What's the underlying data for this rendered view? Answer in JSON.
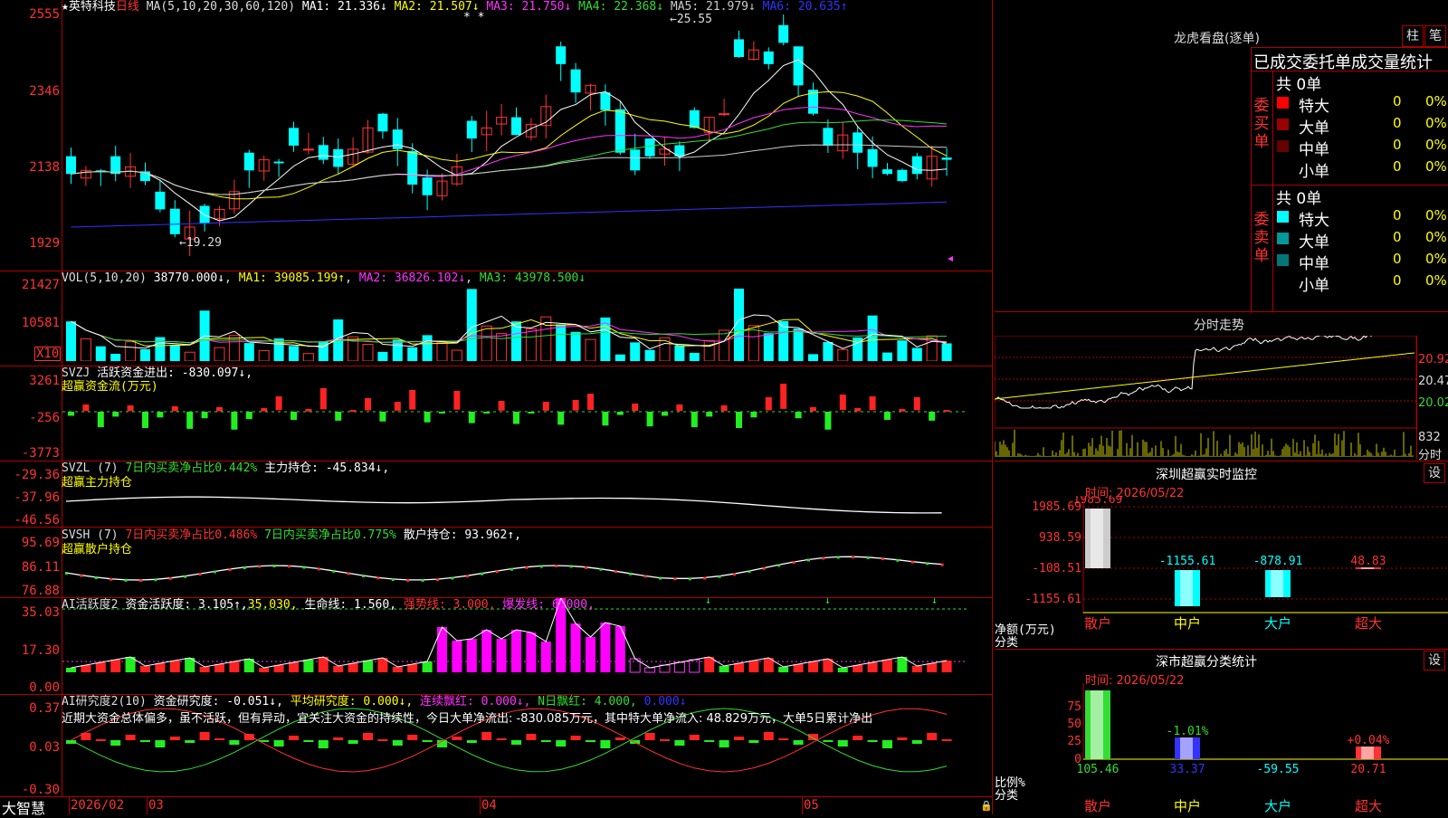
{
  "stock": {
    "star": "★",
    "name": "英特科技",
    "period": "日线"
  },
  "main": {
    "ma_label": "MA(5,10,20,30,60,120)",
    "ma_values": [
      {
        "name": "MA1",
        "val": "21.336↓",
        "color": "#ffffff"
      },
      {
        "name": "MA2",
        "val": "21.507↓",
        "color": "#ffff00"
      },
      {
        "name": "MA3",
        "val": "21.750↓",
        "color": "#ff33ff"
      },
      {
        "name": "MA4",
        "val": "22.368↓",
        "color": "#33dd33"
      },
      {
        "name": "MA5",
        "val": "21.979↓",
        "color": "#cccccc"
      },
      {
        "name": "MA6",
        "val": "20.635↑",
        "color": "#3333ff"
      }
    ],
    "yticks": [
      "2555",
      "2346",
      "2138",
      "1929"
    ],
    "high_mark": "25.55",
    "low_mark": "19.29",
    "flags": "* *"
  },
  "vol": {
    "label": "VOL(5,10,20)",
    "cur": "38770.000↓",
    "ma1": "MA1: 39085.199↑",
    "ma2": "MA2: 36826.102↓",
    "ma3": "MA3: 43978.500↓",
    "yticks": [
      "21427",
      "10581"
    ],
    "unit": "X10"
  },
  "svzj": {
    "label": "SVZJ",
    "title": "活跃资金进出: -830.097↓,",
    "sub": "超赢资金流(万元)",
    "yticks": [
      "3261",
      "-256",
      "-3773"
    ]
  },
  "svzl": {
    "label": "SVZL (7)",
    "p1": "7日内买卖净占比0.442%",
    "p2": "主力持仓: -45.834↓,",
    "sub": "超赢主力持仓",
    "yticks": [
      "-29.36",
      "-37.96",
      "-46.56"
    ]
  },
  "svsh": {
    "label": "SVSH (7)",
    "p1": "7日内买卖净占比0.486%",
    "p2": "7日内买卖净占比0.775%",
    "p3": "散户持仓: 93.962↑,",
    "sub": "超赢散户持仓",
    "yticks": [
      "95.69",
      "86.11",
      "76.88"
    ]
  },
  "ai2": {
    "label": "AI活跃度2",
    "p1": "资金活跃度: 3.105↑,",
    "p2": "35.030,",
    "p3": "生命线: 1.560,",
    "p4": "强势线: 3.000,",
    "p5": "爆发线: 6.000,",
    "yticks": [
      "35.03",
      "17.30",
      "0.00"
    ]
  },
  "ai_res": {
    "label": "AI研究度2(10)",
    "p1": "资金研究度: -0.051↓,",
    "p2": "平均研究度: 0.000↓,",
    "p3": "连续飘红: 0.000↓,",
    "p4": "N日飘红: 4.000,",
    "p5": "0.000↓",
    "text": "近期大资金总体偏多，虽不活跃，但有异动，宜关注大资金的持续性，今日大单净流出: -830.085万元，其中特大单净流入: 48.829万元，大单5日累计净出",
    "yticks": [
      "0.37",
      "0.03",
      "-0.30"
    ]
  },
  "xaxis": {
    "brand": "大智慧",
    "ticks": [
      "2026/02",
      "03",
      "04",
      "05"
    ]
  },
  "lhb": {
    "title": "龙虎看盘(逐单)",
    "btn1": "柱",
    "btn2": "笔",
    "subtitle": "已成交委托单成交量统计",
    "buy": {
      "side": "委买单",
      "total": "共 0单",
      "rows": [
        {
          "name": "特大",
          "n": "0",
          "p": "0%",
          "c": "#ff0000"
        },
        {
          "name": "大单",
          "n": "0",
          "p": "0%",
          "c": "#990000"
        },
        {
          "name": "中单",
          "n": "0",
          "p": "0%",
          "c": "#660000"
        },
        {
          "name": "小单",
          "n": "0",
          "p": "0%",
          "c": ""
        }
      ]
    },
    "sell": {
      "side": "委卖单",
      "total": "共 0单",
      "rows": [
        {
          "name": "特大",
          "n": "0",
          "p": "0%",
          "c": "#00ffff"
        },
        {
          "name": "大单",
          "n": "0",
          "p": "0%",
          "c": "#009999"
        },
        {
          "name": "中单",
          "n": "0",
          "p": "0%",
          "c": "#007777"
        },
        {
          "name": "小单",
          "n": "0",
          "p": "0%",
          "c": ""
        }
      ]
    }
  },
  "fs": {
    "title": "分时走势",
    "yticks": [
      "20.92",
      "20.47",
      "20.02"
    ],
    "vol": "832",
    "vol_unit": "分时"
  },
  "sz_mon": {
    "title": "深圳超赢实时监控",
    "btn": "设",
    "time": "时间: 2026/05/22",
    "yticks": [
      "1985.69",
      "938.59",
      "-108.51",
      "-1155.61"
    ],
    "ylab1": "净额(万元)",
    "ylab2": "分类",
    "values": [
      "1985.69",
      "-1155.61",
      "-878.91",
      "48.83"
    ],
    "cats": [
      "散户",
      "中户",
      "大户",
      "超大"
    ]
  },
  "sz_cls": {
    "title": "深市超赢分类统计",
    "btn": "设",
    "time": "时间: 2026/05/22",
    "yticks": [
      "75",
      "50",
      "25",
      "0"
    ],
    "ylab1": "比例%",
    "ylab2": "分类",
    "changes": [
      "",
      "-1.01%",
      "",
      "+0.04%"
    ],
    "values": [
      "105.46",
      "33.37",
      "-59.55",
      "20.71"
    ],
    "cats": [
      "散户",
      "中户",
      "大户",
      "超大"
    ]
  },
  "chart_data": {
    "type": "bar",
    "note_x": "daily candles 2026/02 - 2026/05",
    "price_range": [
      19.29,
      25.55
    ],
    "ma": {
      "MA1": 21.336,
      "MA2": 21.507,
      "MA3": 21.75,
      "MA4": 22.368,
      "MA5": 21.979,
      "MA6": 20.635
    },
    "volume_last": 38770,
    "fund_flow_last": -830.097,
    "svzl_last": -45.834,
    "svsh_last": 93.962,
    "sz_net": {
      "categories": [
        "散户",
        "中户",
        "大户",
        "超大"
      ],
      "values": [
        1985.69,
        -1155.61,
        -878.91,
        48.83
      ]
    },
    "sz_ratio": {
      "categories": [
        "散户",
        "中户",
        "大户",
        "超大"
      ],
      "values": [
        105.46,
        33.37,
        -59.55,
        20.71
      ]
    }
  }
}
